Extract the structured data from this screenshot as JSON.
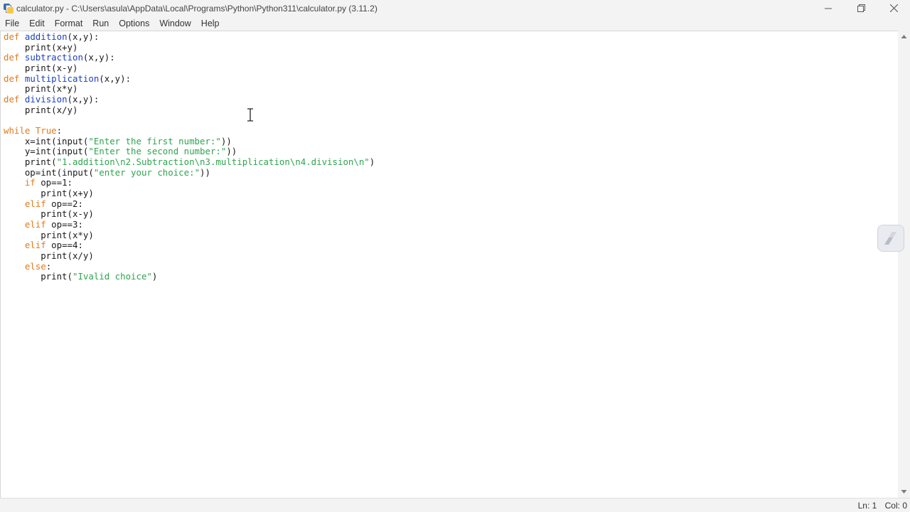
{
  "window": {
    "title": "calculator.py - C:\\Users\\asula\\AppData\\Local\\Programs\\Python\\Python311\\calculator.py (3.11.2)",
    "icon": "python-idle-icon",
    "controls": [
      "minimize-icon",
      "maximize-icon",
      "close-icon"
    ]
  },
  "menu": {
    "items": [
      "File",
      "Edit",
      "Format",
      "Run",
      "Options",
      "Window",
      "Help"
    ]
  },
  "editor": {
    "lines": [
      [
        {
          "t": "def",
          "c": "kw"
        },
        {
          "t": " "
        },
        {
          "t": "addition",
          "c": "fn"
        },
        {
          "t": "(x,y):"
        }
      ],
      [
        {
          "t": "    print(x+y)"
        }
      ],
      [
        {
          "t": "def",
          "c": "kw"
        },
        {
          "t": " "
        },
        {
          "t": "subtraction",
          "c": "fn"
        },
        {
          "t": "(x,y):"
        }
      ],
      [
        {
          "t": "    print(x-y)"
        }
      ],
      [
        {
          "t": "def",
          "c": "kw"
        },
        {
          "t": " "
        },
        {
          "t": "multiplication",
          "c": "fn"
        },
        {
          "t": "(x,y):"
        }
      ],
      [
        {
          "t": "    print(x*y)"
        }
      ],
      [
        {
          "t": "def",
          "c": "kw"
        },
        {
          "t": " "
        },
        {
          "t": "division",
          "c": "fn"
        },
        {
          "t": "(x,y):"
        }
      ],
      [
        {
          "t": "    print(x/y)"
        }
      ],
      [
        {
          "t": ""
        }
      ],
      [
        {
          "t": "while",
          "c": "kw"
        },
        {
          "t": " "
        },
        {
          "t": "True",
          "c": "kw"
        },
        {
          "t": ":"
        }
      ],
      [
        {
          "t": "    x=int(input("
        },
        {
          "t": "\"Enter the first number:\"",
          "c": "str"
        },
        {
          "t": "))"
        }
      ],
      [
        {
          "t": "    y=int(input("
        },
        {
          "t": "\"Enter the second number:\"",
          "c": "str"
        },
        {
          "t": "))"
        }
      ],
      [
        {
          "t": "    print("
        },
        {
          "t": "\"1.addition\\n2.Subtraction\\n3.multiplication\\n4.division\\n\"",
          "c": "str"
        },
        {
          "t": ")"
        }
      ],
      [
        {
          "t": "    op=int(input("
        },
        {
          "t": "\"enter your choice:\"",
          "c": "str"
        },
        {
          "t": "))"
        }
      ],
      [
        {
          "t": "    "
        },
        {
          "t": "if",
          "c": "kw"
        },
        {
          "t": " op==1:"
        }
      ],
      [
        {
          "t": "       print(x+y)"
        }
      ],
      [
        {
          "t": "    "
        },
        {
          "t": "elif",
          "c": "kw"
        },
        {
          "t": " op==2:"
        }
      ],
      [
        {
          "t": "       print(x-y)"
        }
      ],
      [
        {
          "t": "    "
        },
        {
          "t": "elif",
          "c": "kw"
        },
        {
          "t": " op==3:"
        }
      ],
      [
        {
          "t": "       print(x*y)"
        }
      ],
      [
        {
          "t": "    "
        },
        {
          "t": "elif",
          "c": "kw"
        },
        {
          "t": " op==4:"
        }
      ],
      [
        {
          "t": "       print(x/y)"
        }
      ],
      [
        {
          "t": "    "
        },
        {
          "t": "else",
          "c": "kw"
        },
        {
          "t": ":"
        }
      ],
      [
        {
          "t": "       print("
        },
        {
          "t": "\"Ivalid choice\"",
          "c": "str"
        },
        {
          "t": ")"
        }
      ]
    ]
  },
  "status": {
    "line": "Ln: 1",
    "col": "Col: 0"
  },
  "colors": {
    "keyword": "#e07a1b",
    "definition": "#1c3fbf",
    "string": "#2ea44f"
  },
  "overlay": {
    "widget_icon": "snipping-tool-icon",
    "cursor_icon": "text-cursor-icon"
  }
}
